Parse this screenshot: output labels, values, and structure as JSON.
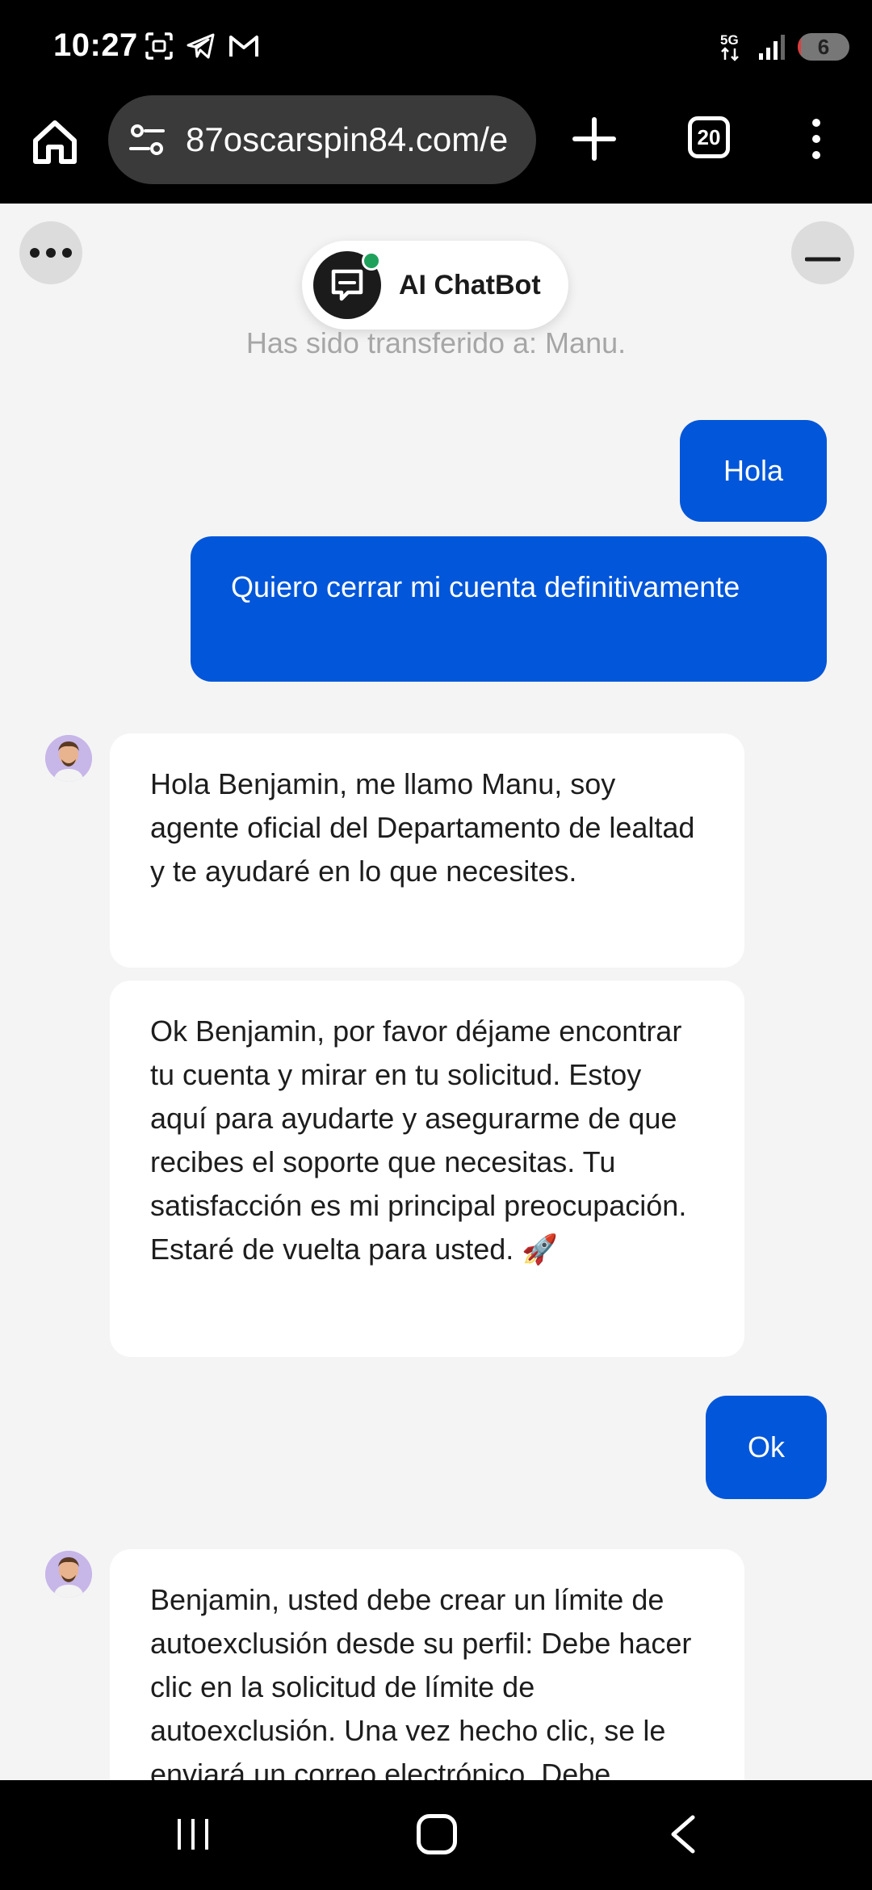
{
  "status_bar": {
    "time": "10:27",
    "network": "5G",
    "battery_level": "6",
    "battery_fraction": 0.06,
    "battery_color": "#e23b3b"
  },
  "browser": {
    "url": "87oscarspin84.com/e",
    "tab_count": "20"
  },
  "chat": {
    "header_title": "AI ChatBot",
    "online_color": "#1fa15c",
    "system_note": "Has sido transferido a: Manu.",
    "user_bubble_color": "#0256d9",
    "messages": [
      {
        "from": "user",
        "text": "Hola"
      },
      {
        "from": "user",
        "text": "Quiero cerrar mi cuenta definitivamente"
      },
      {
        "from": "agent",
        "text": "Hola Benjamin, me llamo Manu, soy agente oficial del Departamento de lealtad y te ayudaré en lo que necesites."
      },
      {
        "from": "agent",
        "text": "Ok Benjamin, por favor déjame encontrar tu cuenta y mirar en tu solicitud. Estoy aquí para ayudarte y asegurarme de que recibes el soporte que necesitas. Tu satisfacción es mi principal preocupación. Estaré de vuelta para usted. 🚀"
      },
      {
        "from": "user",
        "text": "Ok"
      },
      {
        "from": "agent",
        "text": "Benjamin, usted debe crear un límite de autoexclusión desde su perfil: Debe hacer clic en la solicitud de límite de autoexclusión. Una vez hecho clic, se le enviará un correo electrónico. Debe"
      }
    ]
  }
}
